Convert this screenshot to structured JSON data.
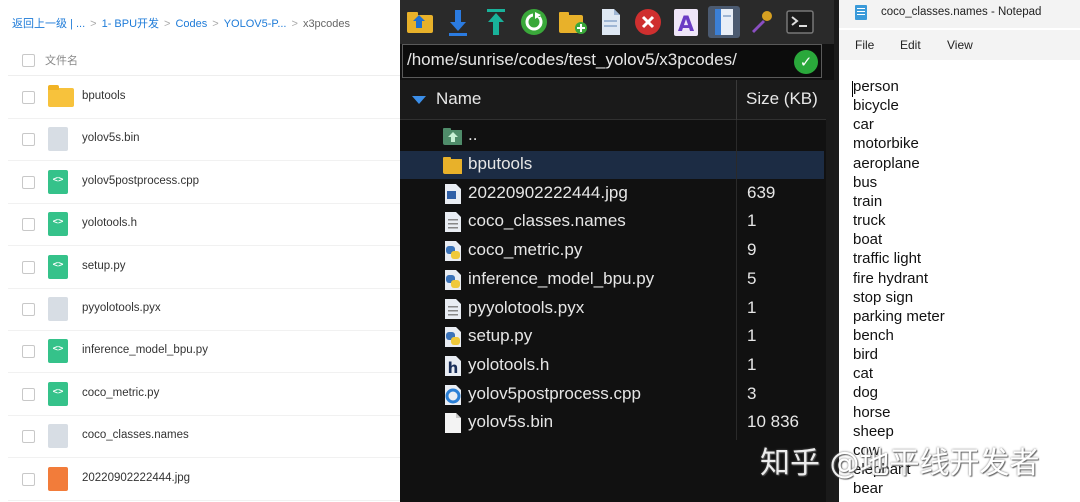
{
  "left_panel": {
    "breadcrumbs": [
      "返回上一级 | ...",
      "1- BPU开发",
      "Codes",
      "YOLOV5-P..."
    ],
    "breadcrumb_current": "x3pcodes",
    "breadcrumb_separator": ">",
    "header_label": "文件名",
    "files": [
      {
        "name": "bputools",
        "type": "folder"
      },
      {
        "name": "yolov5s.bin",
        "type": "bin"
      },
      {
        "name": "yolov5postprocess.cpp",
        "type": "code"
      },
      {
        "name": "yolotools.h",
        "type": "code"
      },
      {
        "name": "setup.py",
        "type": "code"
      },
      {
        "name": "pyyolotools.pyx",
        "type": "bin"
      },
      {
        "name": "inference_model_bpu.py",
        "type": "code"
      },
      {
        "name": "coco_metric.py",
        "type": "code"
      },
      {
        "name": "coco_classes.names",
        "type": "bin"
      },
      {
        "name": "20220902222444.jpg",
        "type": "image"
      }
    ],
    "code_glyph": "<>"
  },
  "middle_panel": {
    "toolbar_icons": [
      "up-folder-icon",
      "download-icon",
      "upload-icon",
      "refresh-icon",
      "new-folder-icon",
      "new-file-icon",
      "delete-icon",
      "rename-icon",
      "preview-icon",
      "find-icon",
      "terminal-icon"
    ],
    "path": "/home/sunrise/codes/test_yolov5/x3pcodes/",
    "path_ok": "✓",
    "col_name": "Name",
    "col_size": "Size (KB)",
    "parent_dir": "..",
    "entries": [
      {
        "name": "bputools",
        "size": "",
        "icon": "folder-icon"
      },
      {
        "name": "20220902222444.jpg",
        "size": "639",
        "icon": "image-file-icon"
      },
      {
        "name": "coco_classes.names",
        "size": "1",
        "icon": "text-file-icon"
      },
      {
        "name": "coco_metric.py",
        "size": "9",
        "icon": "python-file-icon"
      },
      {
        "name": "inference_model_bpu.py",
        "size": "5",
        "icon": "python-file-icon"
      },
      {
        "name": "pyyolotools.pyx",
        "size": "1",
        "icon": "text-file-icon"
      },
      {
        "name": "setup.py",
        "size": "1",
        "icon": "python-file-icon"
      },
      {
        "name": "yolotools.h",
        "size": "1",
        "icon": "header-file-icon"
      },
      {
        "name": "yolov5postprocess.cpp",
        "size": "3",
        "icon": "cpp-file-icon"
      },
      {
        "name": "yolov5s.bin",
        "size": "10 836",
        "icon": "binary-file-icon"
      }
    ]
  },
  "notepad": {
    "title": "coco_classes.names - Notepad",
    "menu": [
      "File",
      "Edit",
      "View"
    ],
    "lines": [
      "person",
      "bicycle",
      "car",
      "motorbike",
      "aeroplane",
      "bus",
      "train",
      "truck",
      "boat",
      "traffic light",
      "fire hydrant",
      "stop sign",
      "parking meter",
      "bench",
      "bird",
      "cat",
      "dog",
      "horse",
      "sheep",
      "cow",
      "elephant",
      "bear"
    ]
  },
  "watermark": "知乎 @地平线开发者",
  "colors": {
    "left_link": "#1e7bd8",
    "dark_bg": "#111111",
    "selected_row": "#1c2c44",
    "ok_green": "#2aa83b",
    "folder_yellow": "#f7c23c",
    "code_green": "#35c28a",
    "image_orange": "#f27c3a"
  }
}
